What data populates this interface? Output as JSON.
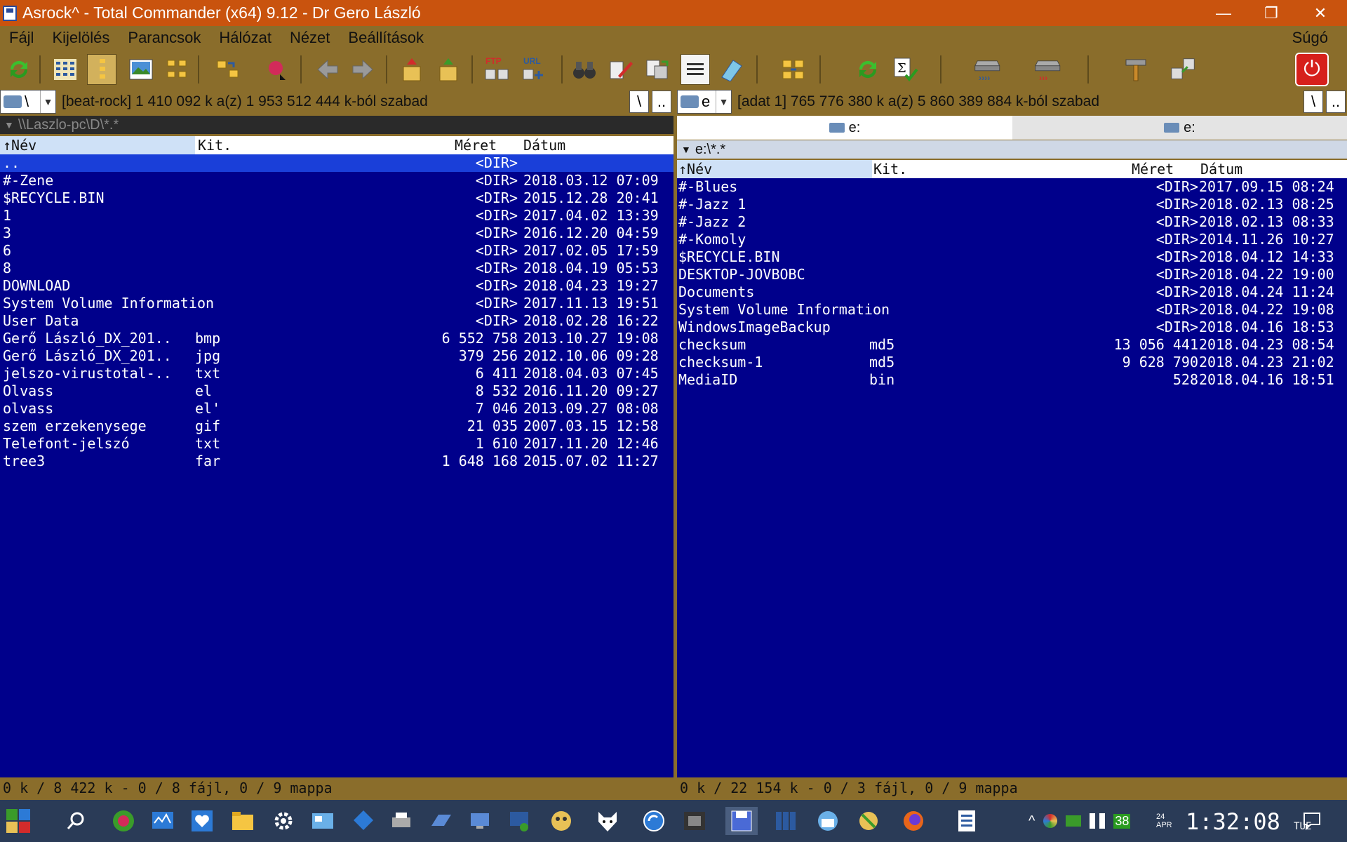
{
  "window": {
    "title": "Asrock^ - Total Commander (x64) 9.12 - Dr Gero László",
    "minimize": "—",
    "maximize": "❐",
    "close": "✕"
  },
  "menu": {
    "items": [
      "Fájl",
      "Kijelölés",
      "Parancsok",
      "Hálózat",
      "Nézet",
      "Beállítások"
    ],
    "help": "Súgó"
  },
  "toolbar": {
    "icons": [
      "refresh-icon",
      "brief-view-icon",
      "tree-view-icon",
      "thumbnail-view-icon",
      "folder-tree-icon",
      "sync-folders-icon",
      "pack-icon",
      "back-arrow-icon",
      "forward-arrow-icon",
      "pack-files-icon",
      "unpack-files-icon",
      "ftp-connect-icon",
      "url-connect-icon",
      "search-binoculars-icon",
      "multi-rename-icon",
      "copy-names-icon",
      "compare-icon",
      "notepad-icon",
      "sync-dirs-icon",
      "reload-icon",
      "checksum-icon",
      "drive-forward-icon",
      "drive-back-icon",
      "hammer-icon",
      "tools-icon",
      "power-icon"
    ],
    "ftp_label": "FTP",
    "url_label": "URL"
  },
  "left": {
    "drive": "\\",
    "drive_info": "[beat-rock]  1 410 092 k a(z) 1 953 512 444 k-ból szabad",
    "path": "\\\\Laszlo-pc\\D\\*.*",
    "root_btn": "\\",
    "up_btn": "..",
    "columns": {
      "name": "Név",
      "ext": "Kit.",
      "size": "Méret",
      "date": "Dátum"
    },
    "files": [
      {
        "name": "..",
        "ext": "",
        "size": "<DIR>",
        "date": ""
      },
      {
        "name": "#-Zene",
        "ext": "",
        "size": "<DIR>",
        "date": "2018.03.12 07:09"
      },
      {
        "name": "$RECYCLE.BIN",
        "ext": "",
        "size": "<DIR>",
        "date": "2015.12.28 20:41"
      },
      {
        "name": "1",
        "ext": "",
        "size": "<DIR>",
        "date": "2017.04.02 13:39"
      },
      {
        "name": "3",
        "ext": "",
        "size": "<DIR>",
        "date": "2016.12.20 04:59"
      },
      {
        "name": "6",
        "ext": "",
        "size": "<DIR>",
        "date": "2017.02.05 17:59"
      },
      {
        "name": "8",
        "ext": "",
        "size": "<DIR>",
        "date": "2018.04.19 05:53"
      },
      {
        "name": "DOWNLOAD",
        "ext": "",
        "size": "<DIR>",
        "date": "2018.04.23 19:27"
      },
      {
        "name": "System Volume Information",
        "ext": "",
        "size": "<DIR>",
        "date": "2017.11.13 19:51"
      },
      {
        "name": "User Data",
        "ext": "",
        "size": "<DIR>",
        "date": "2018.02.28 16:22"
      },
      {
        "name": "Gerő László_DX_201..",
        "ext": "bmp",
        "size": "6 552 758",
        "date": "2013.10.27 19:08"
      },
      {
        "name": "Gerő László_DX_201..",
        "ext": "jpg",
        "size": "379 256",
        "date": "2012.10.06 09:28"
      },
      {
        "name": "jelszo-virustotal-..",
        "ext": "txt",
        "size": "6 411",
        "date": "2018.04.03 07:45"
      },
      {
        "name": "Olvass",
        "ext": "el",
        "size": "8 532",
        "date": "2016.11.20 09:27"
      },
      {
        "name": "olvass",
        "ext": "el'",
        "size": "7 046",
        "date": "2013.09.27 08:08"
      },
      {
        "name": "szem erzekenysege",
        "ext": "gif",
        "size": "21 035",
        "date": "2007.03.15 12:58"
      },
      {
        "name": "Telefont-jelszó",
        "ext": "txt",
        "size": "1 610",
        "date": "2017.11.20 12:46"
      },
      {
        "name": "tree3",
        "ext": "far",
        "size": "1 648 168",
        "date": "2015.07.02 11:27"
      }
    ],
    "status": "0 k / 8 422 k - 0 / 8 fájl, 0 / 9 mappa"
  },
  "right": {
    "drive": "e",
    "drive_info": "[adat 1]  765 776 380 k a(z) 5 860 389 884 k-ból szabad",
    "tabs": [
      "e:",
      "e:"
    ],
    "path": "e:\\*.*",
    "root_btn": "\\",
    "up_btn": "..",
    "columns": {
      "name": "Név",
      "ext": "Kit.",
      "size": "Méret",
      "date": "Dátum"
    },
    "files": [
      {
        "name": "#-Blues",
        "ext": "",
        "size": "<DIR>",
        "date": "2017.09.15 08:24"
      },
      {
        "name": "#-Jazz 1",
        "ext": "",
        "size": "<DIR>",
        "date": "2018.02.13 08:25"
      },
      {
        "name": "#-Jazz 2",
        "ext": "",
        "size": "<DIR>",
        "date": "2018.02.13 08:33"
      },
      {
        "name": "#-Komoly",
        "ext": "",
        "size": "<DIR>",
        "date": "2014.11.26 10:27"
      },
      {
        "name": "$RECYCLE.BIN",
        "ext": "",
        "size": "<DIR>",
        "date": "2018.04.12 14:33"
      },
      {
        "name": "DESKTOP-JOVBOBC",
        "ext": "",
        "size": "<DIR>",
        "date": "2018.04.22 19:00"
      },
      {
        "name": "Documents",
        "ext": "",
        "size": "<DIR>",
        "date": "2018.04.24 11:24"
      },
      {
        "name": "System Volume Information",
        "ext": "",
        "size": "<DIR>",
        "date": "2018.04.22 19:08"
      },
      {
        "name": "WindowsImageBackup",
        "ext": "",
        "size": "<DIR>",
        "date": "2018.04.16 18:53"
      },
      {
        "name": "checksum",
        "ext": "md5",
        "size": "13 056 441",
        "date": "2018.04.23 08:54"
      },
      {
        "name": "checksum-1",
        "ext": "md5",
        "size": "9 628 790",
        "date": "2018.04.23 21:02"
      },
      {
        "name": "MediaID",
        "ext": "bin",
        "size": "528",
        "date": "2018.04.16 18:51"
      }
    ],
    "status": "0 k / 22 154 k - 0 / 3 fájl, 0 / 9 mappa"
  },
  "taskbar": {
    "tray_badge": "38",
    "clock": "1:32:08",
    "date_small": "24 APR",
    "day": "TUE"
  },
  "colors": {
    "panel_bg": "#00008b",
    "cursor_bg": "#1a3fd9",
    "chrome": "#8a6d2b",
    "titlebar": "#c9530e",
    "taskbar": "#2a3b57"
  }
}
